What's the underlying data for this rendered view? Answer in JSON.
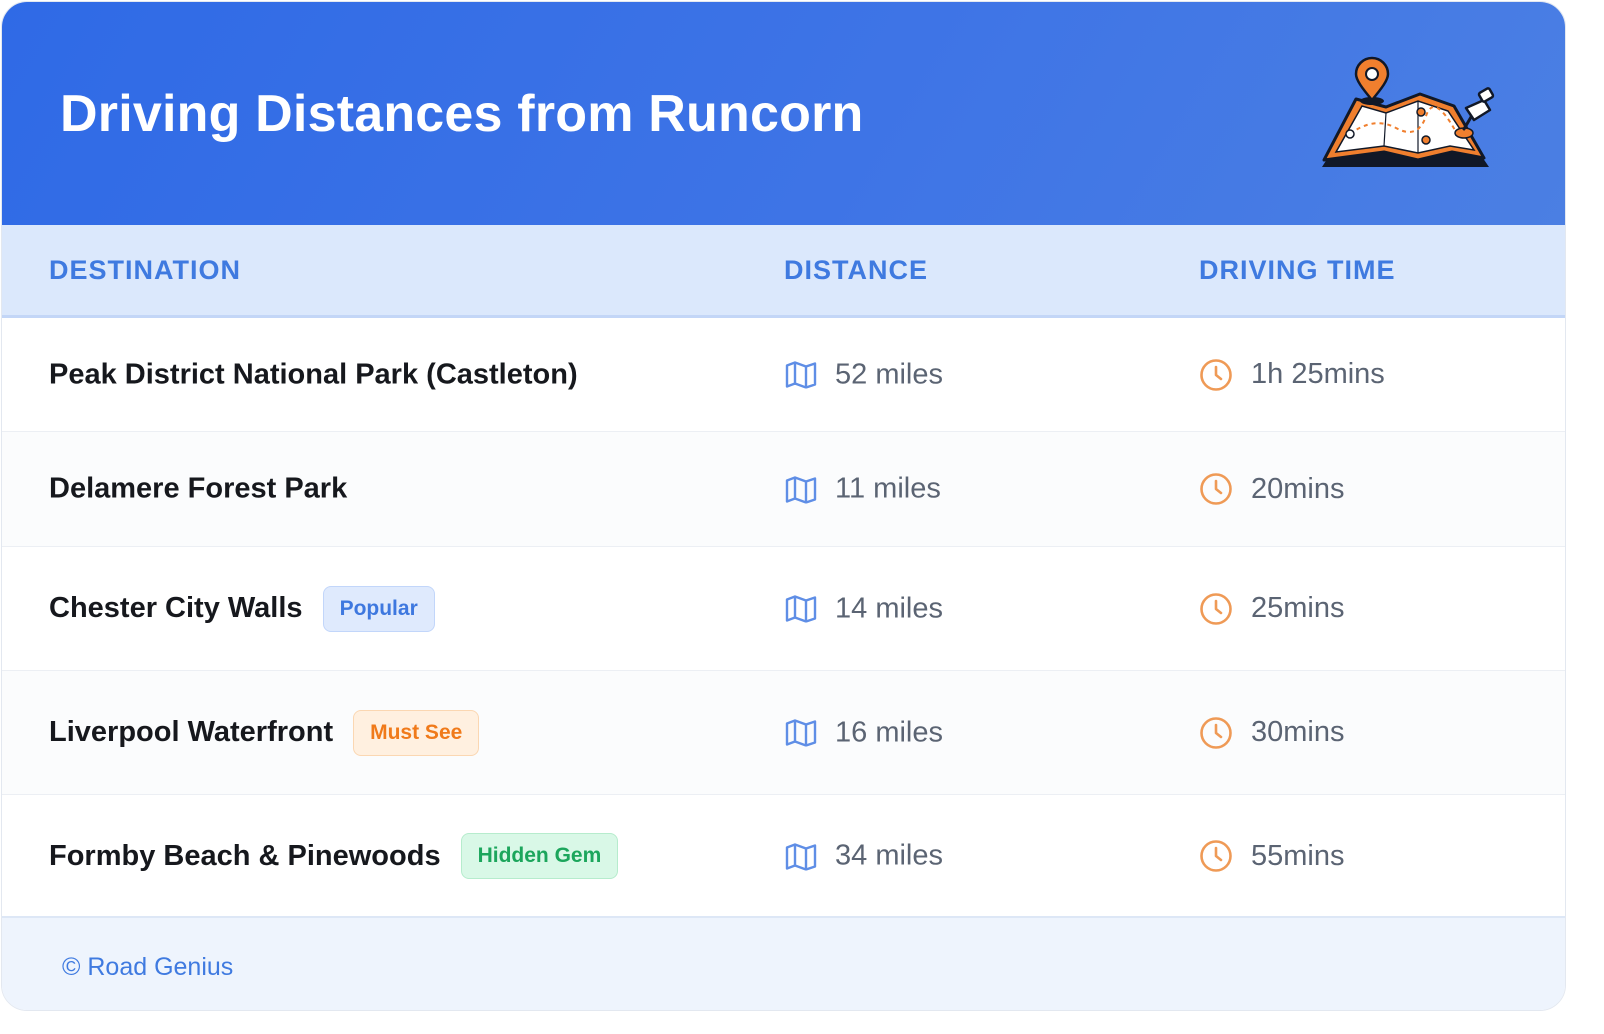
{
  "header": {
    "title": "Driving Distances from Runcorn",
    "illustration_icon": "map-with-pins-icon"
  },
  "table": {
    "columns": [
      "DESTINATION",
      "DISTANCE",
      "DRIVING TIME"
    ],
    "rows": [
      {
        "destination": "Peak District National Park (Castleton)",
        "badge": "",
        "distance": "52 miles",
        "time": "1h 25mins"
      },
      {
        "destination": "Delamere Forest Park",
        "badge": "",
        "distance": "11 miles",
        "time": "20mins"
      },
      {
        "destination": "Chester City Walls",
        "badge": "Popular",
        "distance": "14 miles",
        "time": "25mins"
      },
      {
        "destination": "Liverpool Waterfront",
        "badge": "Must See",
        "distance": "16 miles",
        "time": "30mins"
      },
      {
        "destination": "Formby Beach & Pinewoods",
        "badge": "Hidden Gem",
        "distance": "34 miles",
        "time": "55mins"
      }
    ],
    "distance_icon": "map-icon",
    "time_icon": "clock-icon"
  },
  "footer": {
    "text": "© Road Genius"
  },
  "colors": {
    "header_gradient_start": "#2f6ae6",
    "header_gradient_end": "#4b7fe3",
    "header_row_bg": "#dbe8fc",
    "accent_blue": "#3f7ae0",
    "clock_orange": "#ef9a56",
    "badge_popular": "#3e78df",
    "badge_must_see": "#f07a1a",
    "badge_hidden_gem": "#1ca65c"
  }
}
